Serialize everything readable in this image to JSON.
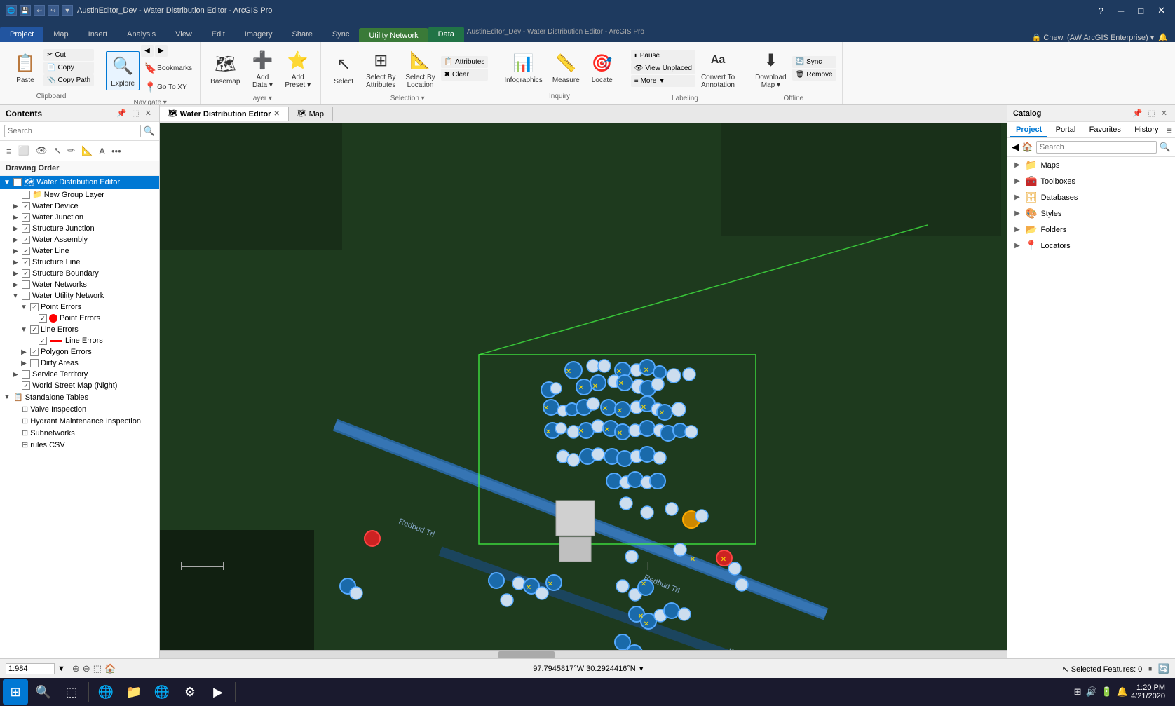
{
  "titleBar": {
    "title": "AustinEditor_Dev - Water Distribution Editor - ArcGIS Pro",
    "quickAccessIcons": [
      "save",
      "undo",
      "redo",
      "customize"
    ],
    "windowControls": [
      "minimize",
      "maximize",
      "close"
    ]
  },
  "ribbonTabs": [
    {
      "label": "Project",
      "active": false,
      "color": "blue"
    },
    {
      "label": "Map",
      "active": false,
      "color": "blue"
    },
    {
      "label": "Insert",
      "active": false
    },
    {
      "label": "Analysis",
      "active": false
    },
    {
      "label": "View",
      "active": false
    },
    {
      "label": "Edit",
      "active": false
    },
    {
      "label": "Imagery",
      "active": false
    },
    {
      "label": "Share",
      "active": false
    },
    {
      "label": "Sync",
      "active": false
    },
    {
      "label": "Utility Network",
      "active": true,
      "color": "green"
    },
    {
      "label": "Data",
      "active": false,
      "color": "data"
    }
  ],
  "ribbon": {
    "groups": [
      {
        "name": "Clipboard",
        "items": [
          {
            "label": "Paste",
            "icon": "📋",
            "type": "large"
          },
          {
            "label": "Cut",
            "icon": "✂️",
            "type": "small"
          },
          {
            "label": "Copy",
            "icon": "📄",
            "type": "small"
          },
          {
            "label": "Copy Path",
            "icon": "📎",
            "type": "small"
          }
        ]
      },
      {
        "name": "Navigate",
        "items": [
          {
            "label": "Explore",
            "icon": "🔍",
            "type": "large"
          },
          {
            "label": "Back",
            "icon": "◀",
            "type": "small"
          },
          {
            "label": "Forward",
            "icon": "▶",
            "type": "small"
          },
          {
            "label": "Bookmarks",
            "icon": "🔖",
            "type": "medium"
          },
          {
            "label": "Go To XY",
            "icon": "📍",
            "type": "medium"
          }
        ]
      },
      {
        "name": "Layer",
        "items": [
          {
            "label": "Basemap",
            "icon": "🗺",
            "type": "large"
          },
          {
            "label": "Add Data",
            "icon": "➕",
            "type": "medium"
          },
          {
            "label": "Add Preset",
            "icon": "⭐",
            "type": "medium"
          }
        ]
      },
      {
        "name": "Selection",
        "items": [
          {
            "label": "Select",
            "icon": "↖",
            "type": "medium"
          },
          {
            "label": "Select By Attributes",
            "icon": "⊞",
            "type": "medium"
          },
          {
            "label": "Select By Location",
            "icon": "📐",
            "type": "medium"
          },
          {
            "label": "Attributes",
            "icon": "📋",
            "type": "small-right"
          },
          {
            "label": "Clear",
            "icon": "✖",
            "type": "small-right"
          }
        ]
      },
      {
        "name": "Inquiry",
        "items": [
          {
            "label": "Infographics",
            "icon": "📊",
            "type": "large"
          },
          {
            "label": "Measure",
            "icon": "📏",
            "type": "medium"
          },
          {
            "label": "Locate",
            "icon": "🎯",
            "type": "medium"
          }
        ]
      },
      {
        "name": "Labeling",
        "items": [
          {
            "label": "Pause",
            "icon": "⏸",
            "type": "small"
          },
          {
            "label": "View Unplaced",
            "icon": "👁",
            "type": "small"
          },
          {
            "label": "More ▼",
            "icon": "",
            "type": "small"
          },
          {
            "label": "Convert To Annotation",
            "icon": "Aa",
            "type": "large"
          }
        ]
      },
      {
        "name": "Offline",
        "items": [
          {
            "label": "Download Map",
            "icon": "⬇",
            "type": "large"
          },
          {
            "label": "Sync",
            "icon": "🔄",
            "type": "small"
          },
          {
            "label": "Remove",
            "icon": "🗑",
            "type": "small"
          }
        ]
      }
    ]
  },
  "contents": {
    "title": "Contents",
    "searchPlaceholder": "Search",
    "drawingOrderLabel": "Drawing Order",
    "layers": [
      {
        "label": "Water Distribution Editor",
        "level": 0,
        "expanded": true,
        "checked": false,
        "hasExpand": true,
        "selected": true
      },
      {
        "label": "New Group Layer",
        "level": 1,
        "expanded": false,
        "checked": false,
        "hasExpand": false
      },
      {
        "label": "Water Device",
        "level": 1,
        "expanded": false,
        "checked": true,
        "hasExpand": true
      },
      {
        "label": "Water Junction",
        "level": 1,
        "expanded": false,
        "checked": true,
        "hasExpand": true
      },
      {
        "label": "Structure Junction",
        "level": 1,
        "expanded": false,
        "checked": true,
        "hasExpand": true
      },
      {
        "label": "Water Assembly",
        "level": 1,
        "expanded": false,
        "checked": true,
        "hasExpand": true
      },
      {
        "label": "Water Line",
        "level": 1,
        "expanded": false,
        "checked": true,
        "hasExpand": true
      },
      {
        "label": "Structure Line",
        "level": 1,
        "expanded": false,
        "checked": true,
        "hasExpand": true
      },
      {
        "label": "Structure Boundary",
        "level": 1,
        "expanded": false,
        "checked": true,
        "hasExpand": true
      },
      {
        "label": "Water Networks",
        "level": 1,
        "expanded": false,
        "checked": false,
        "hasExpand": true
      },
      {
        "label": "Water Utility Network",
        "level": 1,
        "expanded": true,
        "checked": false,
        "hasExpand": true
      },
      {
        "label": "Point Errors",
        "level": 2,
        "expanded": true,
        "checked": true,
        "hasExpand": true
      },
      {
        "label": "Point Errors",
        "level": 3,
        "expanded": false,
        "checked": true,
        "hasExpand": false,
        "legendDot": "red"
      },
      {
        "label": "Line Errors",
        "level": 2,
        "expanded": true,
        "checked": true,
        "hasExpand": true
      },
      {
        "label": "Line Errors",
        "level": 3,
        "expanded": false,
        "checked": true,
        "hasExpand": false,
        "legendLine": "red"
      },
      {
        "label": "Polygon Errors",
        "level": 2,
        "expanded": false,
        "checked": true,
        "hasExpand": true
      },
      {
        "label": "Dirty Areas",
        "level": 2,
        "expanded": false,
        "checked": false,
        "hasExpand": true
      },
      {
        "label": "Service Territory",
        "level": 1,
        "expanded": false,
        "checked": false,
        "hasExpand": true
      },
      {
        "label": "World Street Map (Night)",
        "level": 1,
        "expanded": false,
        "checked": true,
        "hasExpand": false
      },
      {
        "label": "Standalone Tables",
        "level": 0,
        "expanded": true,
        "checked": false,
        "hasExpand": true
      },
      {
        "label": "Valve Inspection",
        "level": 1,
        "expanded": false,
        "checked": false,
        "hasExpand": false,
        "tableIcon": true
      },
      {
        "label": "Hydrant Maintenance Inspection",
        "level": 1,
        "expanded": false,
        "checked": false,
        "hasExpand": false,
        "tableIcon": true
      },
      {
        "label": "Subnetworks",
        "level": 1,
        "expanded": false,
        "checked": false,
        "hasExpand": false,
        "tableIcon": true
      },
      {
        "label": "rules.CSV",
        "level": 1,
        "expanded": false,
        "checked": false,
        "hasExpand": false,
        "tableIcon": true
      }
    ]
  },
  "mapTabs": [
    {
      "label": "Water Distribution Editor",
      "active": true,
      "closeable": true
    },
    {
      "label": "Map",
      "active": false,
      "closeable": false
    }
  ],
  "catalog": {
    "title": "Catalog",
    "navTabs": [
      "Project",
      "Portal",
      "Favorites",
      "History"
    ],
    "activeTab": "Project",
    "searchPlaceholder": "Search",
    "items": [
      {
        "label": "Maps",
        "icon": "map",
        "expanded": false
      },
      {
        "label": "Toolboxes",
        "icon": "toolbox",
        "expanded": false
      },
      {
        "label": "Databases",
        "icon": "database",
        "expanded": false
      },
      {
        "label": "Styles",
        "icon": "style",
        "expanded": false
      },
      {
        "label": "Folders",
        "icon": "folder",
        "expanded": false
      },
      {
        "label": "Locators",
        "icon": "locator",
        "expanded": false
      }
    ]
  },
  "statusBar": {
    "scale": "1:984",
    "coordinates": "97.7945817°W 30.2924416°N",
    "selectedFeatures": "Selected Features: 0"
  },
  "taskbar": {
    "time": "1:20 PM",
    "date": "4/21/2020",
    "searchPlaceholder": "Search"
  }
}
